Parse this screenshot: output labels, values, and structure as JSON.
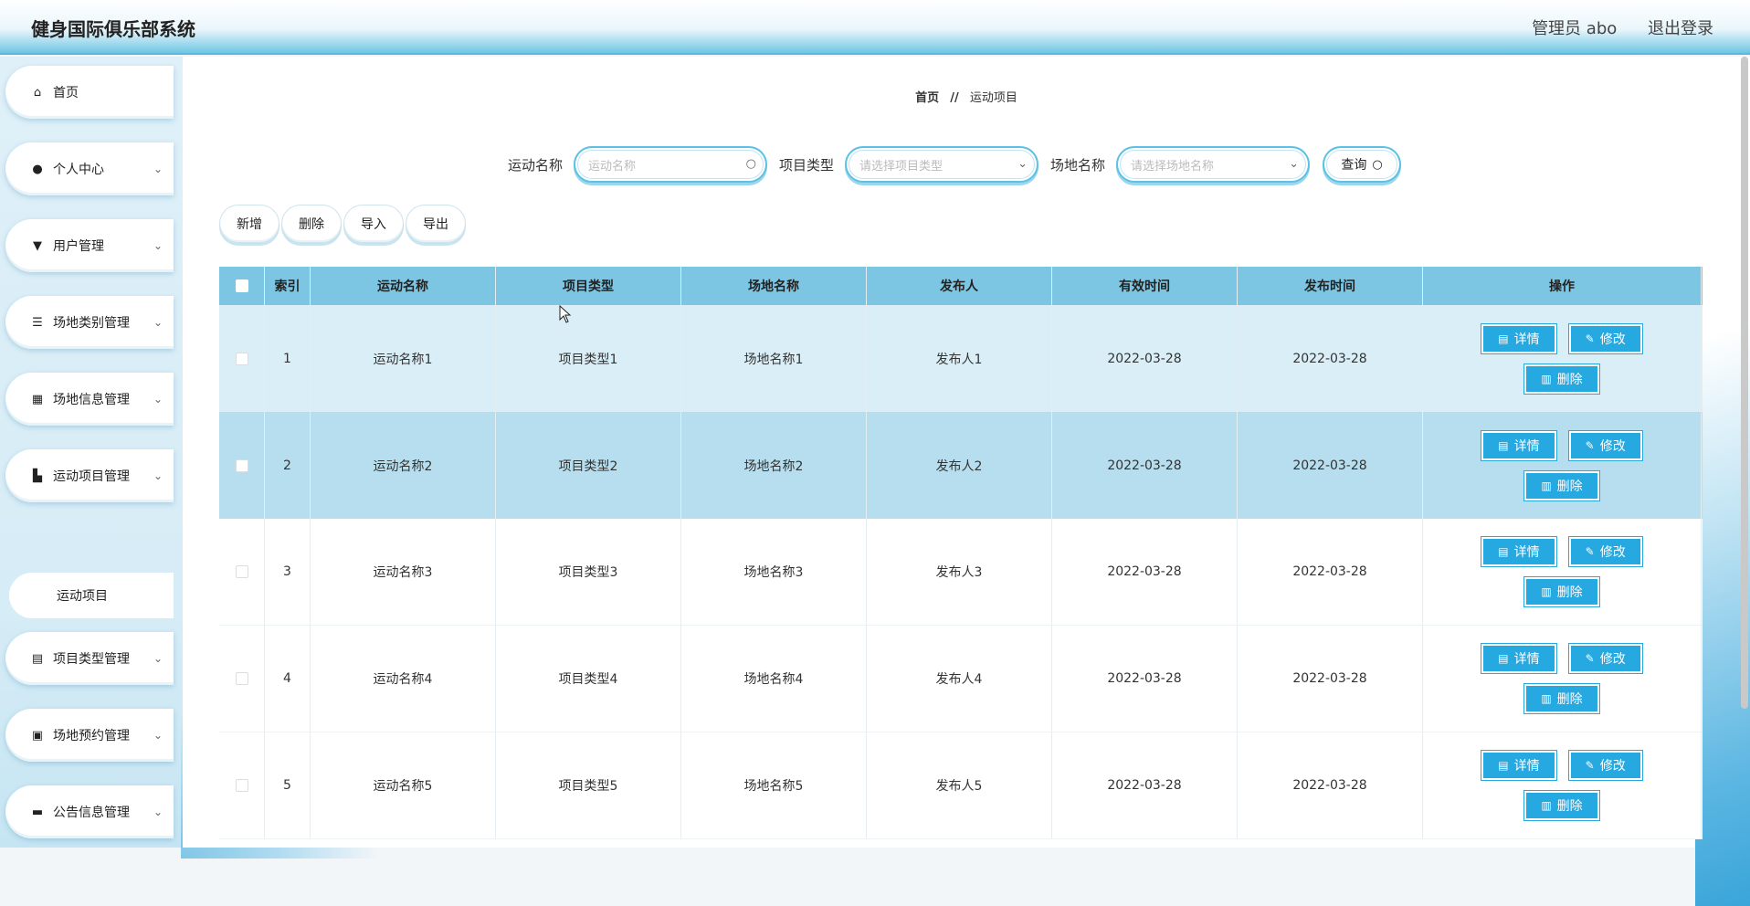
{
  "app": {
    "title": "健身国际俱乐部系统"
  },
  "header": {
    "user": "管理员 abo",
    "logout": "退出登录"
  },
  "sidebar": {
    "items": [
      {
        "label": "首页",
        "icon": "home-icon"
      },
      {
        "label": "个人中心",
        "icon": "person-icon"
      },
      {
        "label": "用户管理",
        "icon": "user-manage-icon"
      },
      {
        "label": "场地类别管理",
        "icon": "list-icon"
      },
      {
        "label": "场地信息管理",
        "icon": "grid-icon"
      },
      {
        "label": "运动项目管理",
        "icon": "sport-icon"
      },
      {
        "label": "项目类型管理",
        "icon": "clipboard-icon"
      },
      {
        "label": "场地预约管理",
        "icon": "briefcase-icon"
      },
      {
        "label": "公告信息管理",
        "icon": "notice-icon"
      }
    ],
    "sub_item": "运动项目"
  },
  "breadcrumb": {
    "home": "首页",
    "sep": "//",
    "current": "运动项目"
  },
  "search": {
    "name_label": "运动名称",
    "name_placeholder": "运动名称",
    "type_label": "项目类型",
    "type_placeholder": "请选择项目类型",
    "venue_label": "场地名称",
    "venue_placeholder": "请选择场地名称",
    "query_button": "查询"
  },
  "actions": {
    "add": "新增",
    "delete": "删除",
    "import": "导入",
    "export": "导出"
  },
  "table": {
    "headers": [
      "索引",
      "运动名称",
      "项目类型",
      "场地名称",
      "发布人",
      "有效时间",
      "发布时间",
      "操作"
    ],
    "rows": [
      [
        "1",
        "运动名称1",
        "项目类型1",
        "场地名称1",
        "发布人1",
        "2022-03-28",
        "2022-03-28"
      ],
      [
        "2",
        "运动名称2",
        "项目类型2",
        "场地名称2",
        "发布人2",
        "2022-03-28",
        "2022-03-28"
      ],
      [
        "3",
        "运动名称3",
        "项目类型3",
        "场地名称3",
        "发布人3",
        "2022-03-28",
        "2022-03-28"
      ],
      [
        "4",
        "运动名称4",
        "项目类型4",
        "场地名称4",
        "发布人4",
        "2022-03-28",
        "2022-03-28"
      ],
      [
        "5",
        "运动名称5",
        "项目类型5",
        "场地名称5",
        "发布人5",
        "2022-03-28",
        "2022-03-28"
      ]
    ],
    "op_detail": "详情",
    "op_edit": "修改",
    "op_delete": "删除"
  },
  "colors": {
    "accent": "#26a9e0",
    "header": "#7cc6e3",
    "row_highlight": "#b6deee"
  }
}
